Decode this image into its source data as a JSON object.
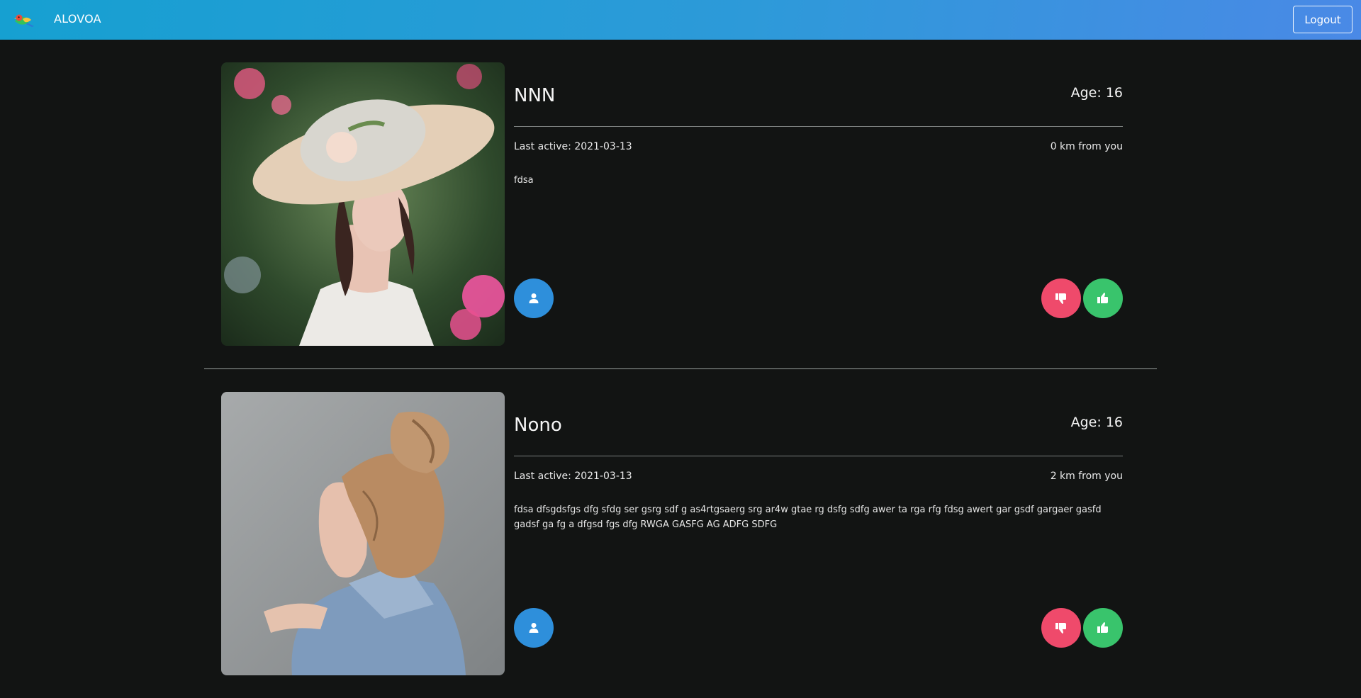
{
  "app": {
    "brand": "ALOVOA",
    "logout_label": "Logout"
  },
  "profiles": [
    {
      "name": "NNN",
      "age": "Age: 16",
      "last_active": "Last active: 2021-03-13",
      "distance": "0 km from you",
      "description": "fdsa"
    },
    {
      "name": "Nono",
      "age": "Age: 16",
      "last_active": "Last active: 2021-03-13",
      "distance": "2 km from you",
      "description": "fdsa dfsgdsfgs dfg sfdg ser gsrg sdf g as4rtgsaerg srg ar4w gtae rg dsfg sdfg awer ta rga rfg fdsg awert gar gsdf gargaer gasfd gadsf ga fg a dfgsd fgs dfg RWGA GASFG AG ADFG SDFG"
    }
  ],
  "icons": {
    "profile": "user-icon",
    "dislike": "thumbs-down-icon",
    "like": "thumbs-up-icon"
  },
  "colors": {
    "navbar_start": "#16a0d1",
    "navbar_end": "#4a89e6",
    "background": "#121413",
    "profile_button": "#2e8fdb",
    "dislike_button": "#ef4a6b",
    "like_button": "#39c46c"
  }
}
